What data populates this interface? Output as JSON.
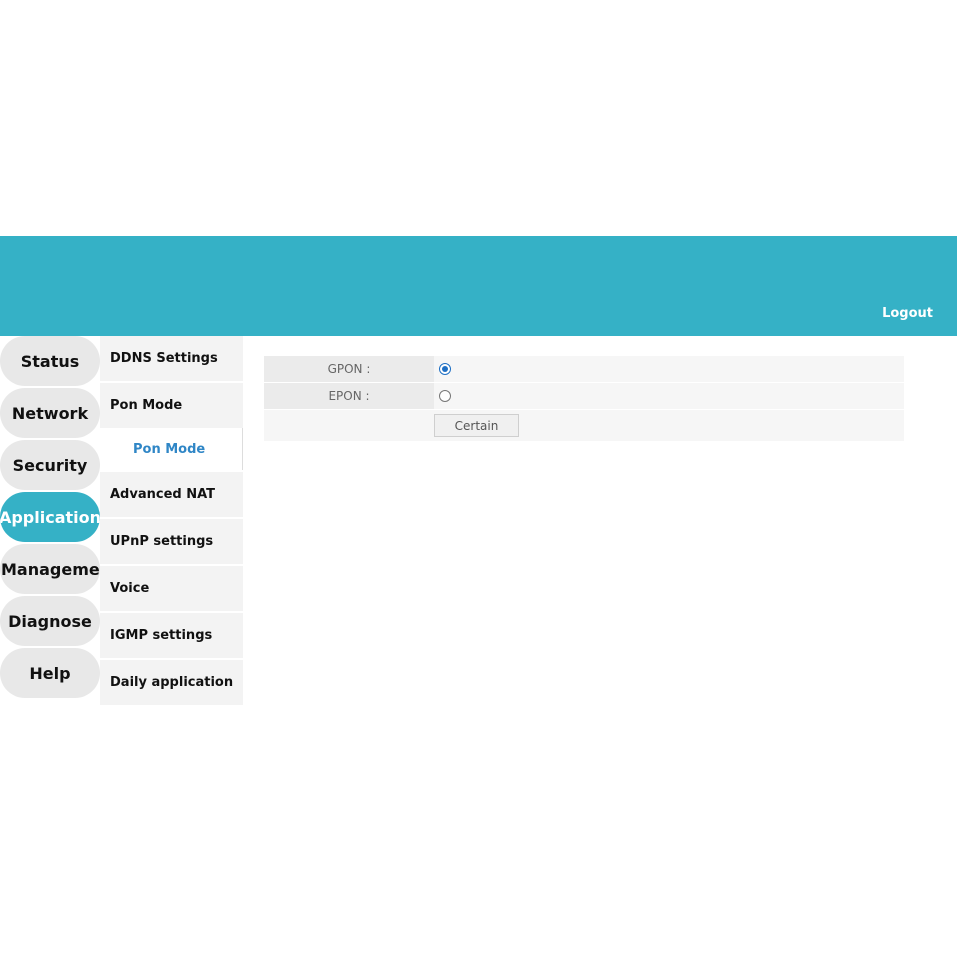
{
  "header": {
    "logout_label": "Logout",
    "color": "#35b1c6"
  },
  "main_nav": {
    "items": [
      {
        "label": "Status"
      },
      {
        "label": "Network"
      },
      {
        "label": "Security"
      },
      {
        "label": "Application",
        "active": true
      },
      {
        "label": "Managemen"
      },
      {
        "label": "Diagnose"
      },
      {
        "label": "Help"
      }
    ]
  },
  "sub_nav": {
    "items": [
      {
        "label": "DDNS Settings"
      },
      {
        "label": "Pon Mode"
      },
      {
        "label": "Pon Mode",
        "child": true,
        "active": true
      },
      {
        "label": "Advanced NAT"
      },
      {
        "label": "UPnP settings"
      },
      {
        "label": "Voice"
      },
      {
        "label": "IGMP settings"
      },
      {
        "label": "Daily application"
      }
    ]
  },
  "form": {
    "gpon_label": "GPON :",
    "epon_label": "EPON :",
    "selected": "GPON",
    "certain_label": "Certain"
  },
  "colors": {
    "accent": "#35b1c6",
    "link_blue": "#2f86c6",
    "radio_blue": "#1e6fc4"
  }
}
